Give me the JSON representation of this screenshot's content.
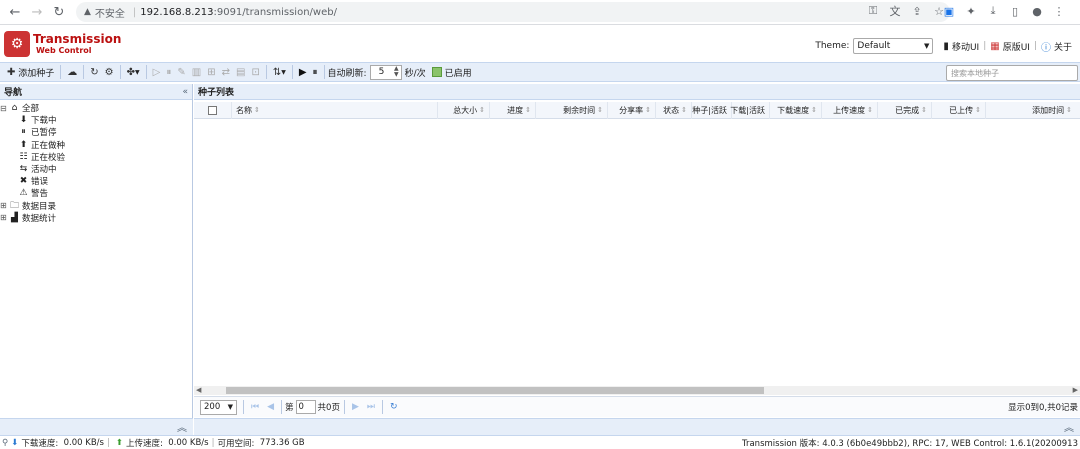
{
  "browser": {
    "security_label": "不安全",
    "url_host": "192.168.8.213",
    "url_path": ":9091/transmission/web/"
  },
  "header": {
    "logo_title": "Transmission",
    "logo_subtitle": "Web Control",
    "theme_label": "Theme:",
    "theme_value": "Default",
    "mobile_ui": "移动UI",
    "original_ui": "原版UI",
    "about": "关于"
  },
  "toolbar": {
    "add_torrent": "添加种子",
    "auto_refresh_label": "自动刷新:",
    "refresh_value": "5",
    "refresh_unit": "秒/次",
    "enabled_label": "已启用",
    "search_placeholder": "搜索本地种子"
  },
  "nav": {
    "title": "导航",
    "items": [
      {
        "label": "全部",
        "icon": "home-icon"
      },
      {
        "label": "下载中",
        "icon": "download-icon"
      },
      {
        "label": "已暂停",
        "icon": "pause-icon"
      },
      {
        "label": "正在做种",
        "icon": "upload-icon"
      },
      {
        "label": "正在校验",
        "icon": "check-icon"
      },
      {
        "label": "活动中",
        "icon": "exchange-icon"
      },
      {
        "label": "错误",
        "icon": "error-icon"
      },
      {
        "label": "警告",
        "icon": "warning-icon"
      },
      {
        "label": "数据目录",
        "icon": "folder-icon"
      },
      {
        "label": "数据统计",
        "icon": "stats-icon"
      }
    ]
  },
  "list": {
    "title": "种子列表",
    "columns": [
      "名称",
      "总大小",
      "进度",
      "剩余时间",
      "分享率",
      "状态",
      "种子|活跃",
      "下载|活跃",
      "下载速度",
      "上传速度",
      "已完成",
      "已上传",
      "添加时间"
    ],
    "page_size": "200",
    "page_prefix": "第",
    "page_value": "0",
    "page_suffix": "共0页",
    "range_info": "显示0到0,共0记录"
  },
  "status": {
    "download_label": "下载速度:",
    "download_value": "0.00 KB/s",
    "upload_label": "上传速度:",
    "upload_value": "0.00 KB/s",
    "free_label": "可用空间:",
    "free_value": "773.36 GB",
    "version": "Transmission 版本: 4.0.3 (6b0e49bbb2), RPC: 17, WEB Control: 1.6.1(20200913"
  }
}
